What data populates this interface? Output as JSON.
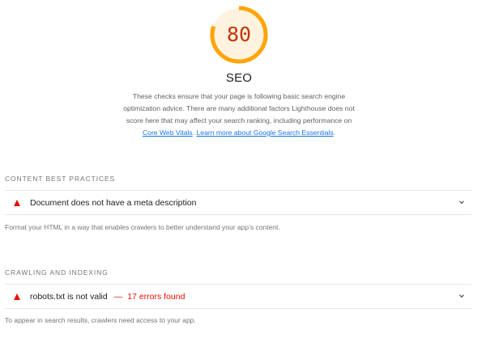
{
  "score": {
    "value": 80,
    "display": "80",
    "fraction": 0.8,
    "color": "#ffa400",
    "text_color": "#c33300",
    "track_color": "#fff3e0"
  },
  "category": {
    "title": "SEO",
    "description_line1": "These checks ensure that your page is following basic search engine",
    "description_line2": "optimization advice. There are many additional factors Lighthouse does not",
    "description_line3": "score here that may affect your search ranking, including performance on",
    "link_core_web_vitals": "Core Web Vitals",
    "link_separator": ". ",
    "link_search_essentials": "Learn more about Google Search Essentials",
    "description_end": "."
  },
  "groups": [
    {
      "title": "CONTENT BEST PRACTICES",
      "audits": [
        {
          "icon": "fail-triangle-icon",
          "title": "Document does not have a meta description",
          "display_value": ""
        }
      ],
      "description": "Format your HTML in a way that enables crawlers to better understand your app’s content."
    },
    {
      "title": "CRAWLING AND INDEXING",
      "audits": [
        {
          "icon": "fail-triangle-icon",
          "title": "robots.txt is not valid",
          "separator": "—",
          "display_value": "17 errors found"
        }
      ],
      "description": "To appear in search results, crawlers need access to your app."
    }
  ],
  "colors": {
    "fail": "#eb0f00",
    "link": "#1a73e8",
    "muted": "#757575"
  }
}
